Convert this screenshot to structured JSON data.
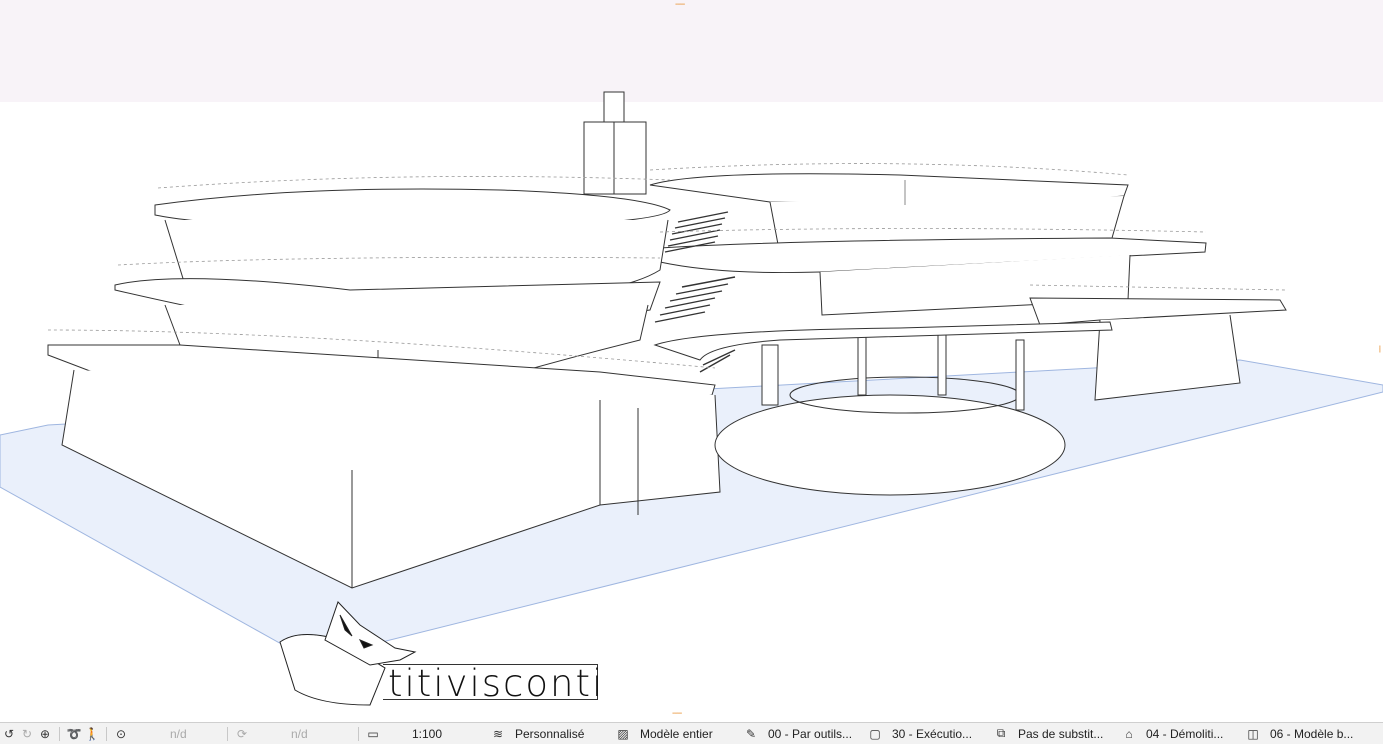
{
  "view": {
    "colors": {
      "ground": "#eaf0fb",
      "ground_edge": "#9fb6e0",
      "band": "#f8f3f8",
      "line": "#333333",
      "handle": "#e8953a"
    }
  },
  "logo": {
    "text": "titivisconti"
  },
  "statusbar": {
    "items": [
      {
        "icon": "zoom-history-icon",
        "value": ""
      },
      {
        "icon": "zoom-icon",
        "value": ""
      },
      {
        "icon": "lasso-icon",
        "value": ""
      },
      {
        "icon": "walk-icon",
        "value": ""
      },
      {
        "icon": "zoom-fit-icon",
        "value": "n/d"
      },
      {
        "icon": "rotate-icon",
        "value": "n/d"
      },
      {
        "icon": "ruler-icon",
        "value": "1:100"
      },
      {
        "icon": "layers-icon",
        "value": "Personnalisé"
      },
      {
        "icon": "hatch-icon",
        "value": "Modèle entier"
      },
      {
        "icon": "pen-icon",
        "value": "00 - Par outils..."
      },
      {
        "icon": "model-view-icon",
        "value": "30 - Exécutio..."
      },
      {
        "icon": "override-icon",
        "value": "Pas de substit..."
      },
      {
        "icon": "renovation-icon",
        "value": "04 - Démoliti..."
      },
      {
        "icon": "3d-box-icon",
        "value": "06 - Modèle b..."
      }
    ]
  }
}
